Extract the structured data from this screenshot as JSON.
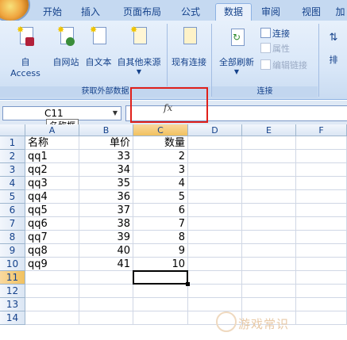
{
  "tabs": [
    {
      "label": "开始"
    },
    {
      "label": "插入"
    },
    {
      "label": "页面布局"
    },
    {
      "label": "公式"
    },
    {
      "label": "数据",
      "active": true
    },
    {
      "label": "审阅"
    },
    {
      "label": "视图"
    },
    {
      "label": "加"
    }
  ],
  "ribbon": {
    "external_group": {
      "caption": "获取外部数据",
      "buttons": [
        {
          "label": "自 Access",
          "icon": "access-icon"
        },
        {
          "label": "自网站",
          "icon": "web-icon"
        },
        {
          "label": "自文本",
          "icon": "text-file-icon"
        },
        {
          "label": "自其他来源",
          "icon": "other-sources-icon"
        },
        {
          "label": "现有连接",
          "icon": "existing-connections-icon"
        }
      ]
    },
    "connections_group": {
      "caption": "连接",
      "refresh_all": "全部刷新",
      "connections": "连接",
      "properties": "属性",
      "edit_links": "编辑链接"
    },
    "cut_label": "排"
  },
  "formula_bar": {
    "name_box": "C11",
    "fx": "fx",
    "tooltip": "名称框",
    "formula": ""
  },
  "sheet": {
    "columns": [
      "A",
      "B",
      "C",
      "D",
      "E",
      "F"
    ],
    "rows": [
      {
        "n": "1",
        "a": "名称",
        "b": "单价",
        "c": "数量"
      },
      {
        "n": "2",
        "a": "qq1",
        "b": "33",
        "c": "2"
      },
      {
        "n": "3",
        "a": "qq2",
        "b": "34",
        "c": "3"
      },
      {
        "n": "4",
        "a": "qq3",
        "b": "35",
        "c": "4"
      },
      {
        "n": "5",
        "a": "qq4",
        "b": "36",
        "c": "5"
      },
      {
        "n": "6",
        "a": "qq5",
        "b": "37",
        "c": "6"
      },
      {
        "n": "7",
        "a": "qq6",
        "b": "38",
        "c": "7"
      },
      {
        "n": "8",
        "a": "qq7",
        "b": "39",
        "c": "8"
      },
      {
        "n": "9",
        "a": "qq8",
        "b": "40",
        "c": "9"
      },
      {
        "n": "10",
        "a": "qq9",
        "b": "41",
        "c": "10"
      },
      {
        "n": "11",
        "a": "",
        "b": "",
        "c": ""
      },
      {
        "n": "12",
        "a": "",
        "b": "",
        "c": ""
      },
      {
        "n": "13",
        "a": "",
        "b": "",
        "c": ""
      },
      {
        "n": "14",
        "a": "",
        "b": "",
        "c": ""
      }
    ],
    "active_cell": "C11"
  },
  "watermark": "游戏常识",
  "colors": {
    "ribbon": "#dbe7f8",
    "highlight": "#e0201a",
    "selected_header": "#f1c15f"
  }
}
